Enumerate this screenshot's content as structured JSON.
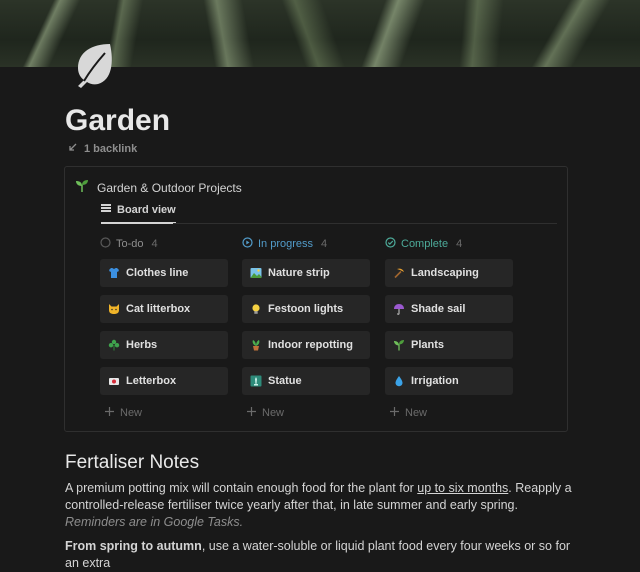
{
  "page": {
    "title": "Garden",
    "backlink": "1 backlink",
    "icon": "leaf-icon"
  },
  "database": {
    "title": "Garden & Outdoor Projects",
    "view_tab": "Board view",
    "columns": [
      {
        "name": "To-do",
        "count": "4",
        "color": "#8e8e8e",
        "cards": [
          {
            "label": "Clothes line",
            "icon": "shirt-icon"
          },
          {
            "label": "Cat litterbox",
            "icon": "cat-icon"
          },
          {
            "label": "Herbs",
            "icon": "shamrock-icon"
          },
          {
            "label": "Letterbox",
            "icon": "mailbox-icon"
          }
        ],
        "new_label": "New"
      },
      {
        "name": "In progress",
        "count": "4",
        "color": "#529cca",
        "cards": [
          {
            "label": "Nature strip",
            "icon": "landscape-icon"
          },
          {
            "label": "Festoon lights",
            "icon": "lightbulb-icon"
          },
          {
            "label": "Indoor repotting",
            "icon": "potted-plant-icon"
          },
          {
            "label": "Statue",
            "icon": "statue-icon"
          }
        ],
        "new_label": "New"
      },
      {
        "name": "Complete",
        "count": "4",
        "color": "#4dab9a",
        "cards": [
          {
            "label": "Landscaping",
            "icon": "pick-icon"
          },
          {
            "label": "Shade sail",
            "icon": "umbrella-icon"
          },
          {
            "label": "Plants",
            "icon": "seedling-icon"
          },
          {
            "label": "Irrigation",
            "icon": "droplet-icon"
          }
        ],
        "new_label": "New"
      }
    ]
  },
  "notes": {
    "heading": "Fertaliser Notes",
    "p1_a": "A premium potting mix will contain enough food for the plant for ",
    "p1_link": "up to six months",
    "p1_b": ". Reapply a controlled-release fertiliser twice yearly after that, in late summer and early spring. ",
    "p1_em": "Reminders are in Google Tasks.",
    "p2_bold": "From spring to autumn",
    "p2_rest": ", use a water-soluble or liquid plant food every four weeks or so for an extra"
  }
}
